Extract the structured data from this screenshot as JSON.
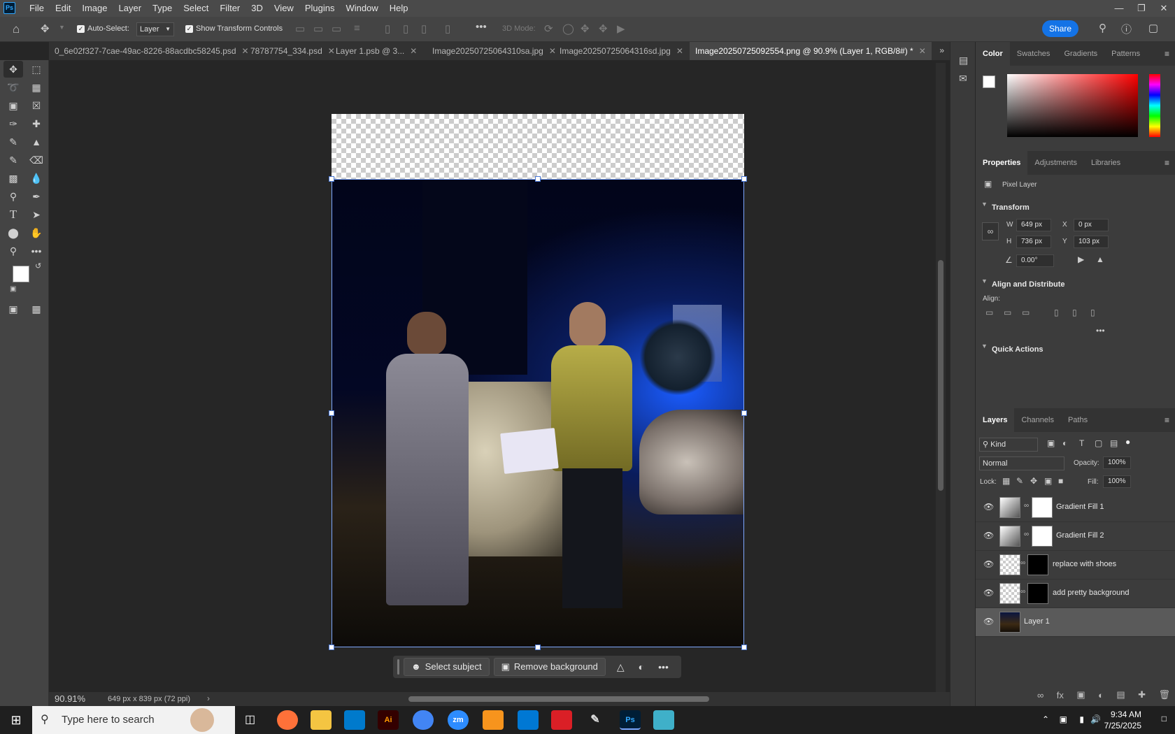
{
  "app": {
    "logo": "Ps"
  },
  "menu": [
    "File",
    "Edit",
    "Image",
    "Layer",
    "Type",
    "Select",
    "Filter",
    "3D",
    "View",
    "Plugins",
    "Window",
    "Help"
  ],
  "options": {
    "auto_select_label": "Auto-Select:",
    "auto_select_value": "Layer",
    "show_transform_label": "Show Transform Controls",
    "mode_3d_label": "3D Mode:",
    "share_label": "Share"
  },
  "tabs": [
    {
      "label": "0_6e02f327-7cae-49ac-8226-88acdbc58245.psd",
      "active": false
    },
    {
      "label": "78787754_334.psd",
      "active": false
    },
    {
      "label": "Layer 1.psb @ 3...",
      "active": false
    },
    {
      "label": "Image20250725064310sa.jpg",
      "active": false
    },
    {
      "label": "Image20250725064316sd.jpg",
      "active": false
    },
    {
      "label": "Image20250725092554.png @ 90.9% (Layer 1, RGB/8#) *",
      "active": true
    }
  ],
  "context_bar": {
    "select_subject": "Select subject",
    "remove_background": "Remove background"
  },
  "status": {
    "zoom": "90.91%",
    "doc_size": "649 px x 839 px (72 ppi)"
  },
  "color_panel": {
    "tabs": [
      "Color",
      "Swatches",
      "Gradients",
      "Patterns"
    ],
    "accent": "#ff0000"
  },
  "properties_panel": {
    "tabs": [
      "Properties",
      "Adjustments",
      "Libraries"
    ],
    "layer_type": "Pixel Layer",
    "transform_title": "Transform",
    "w_label": "W",
    "w_value": "649 px",
    "h_label": "H",
    "h_value": "736 px",
    "x_label": "X",
    "x_value": "0 px",
    "y_label": "Y",
    "y_value": "103 px",
    "angle_value": "0.00°",
    "align_title": "Align and Distribute",
    "align_label": "Align:",
    "quick_actions_title": "Quick Actions"
  },
  "layers_panel": {
    "tabs": [
      "Layers",
      "Channels",
      "Paths"
    ],
    "kind_label": "Kind",
    "blend_mode": "Normal",
    "opacity_label": "Opacity:",
    "opacity_value": "100%",
    "lock_label": "Lock:",
    "fill_label": "Fill:",
    "fill_value": "100%",
    "layers": [
      {
        "name": "Gradient Fill 1",
        "selected": false
      },
      {
        "name": "Gradient Fill 2",
        "selected": false
      },
      {
        "name": "replace with shoes",
        "selected": false
      },
      {
        "name": "add pretty background",
        "selected": false
      },
      {
        "name": "Layer 1",
        "selected": true
      }
    ]
  },
  "taskbar": {
    "search_placeholder": "Type here to search",
    "time": "9:34 AM",
    "date": "7/25/2025",
    "apps": [
      "Firefox",
      "File Explorer",
      "VS Code",
      "Ai",
      "Chrome",
      "zm",
      "App",
      "Outlook",
      "Creative Cloud",
      "Pen",
      "Ps",
      "App2"
    ]
  }
}
